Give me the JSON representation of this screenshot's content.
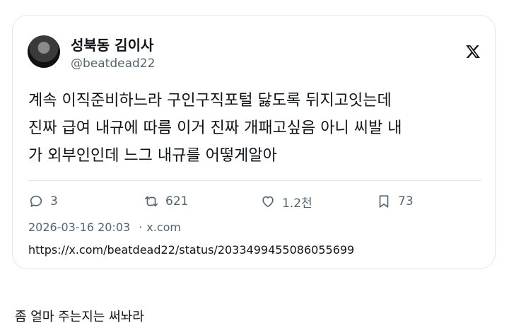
{
  "tweet": {
    "author_name": "성북동 김이사",
    "author_handle": "@beatdead22",
    "text_lines": [
      "계속 이직준비하느라 구인구직포털 닳도록 뒤지고잇는데",
      "진짜 급여 내규에 따름 이거 진짜 개패고싶음 아니 씨발 내",
      "가 외부인인데 느그 내규를 어떻게알아"
    ],
    "actions": {
      "replies": "3",
      "retweets": "621",
      "likes": "1.2천",
      "bookmarks": "73"
    },
    "date": "2026-03-16 20:03",
    "source": "x.com",
    "url": "https://x.com/beatdead22/status/2033499455086055699"
  },
  "post_caption": "좀 얼마 주는지는 써놔라",
  "icons": {
    "logo": "x-logo-icon",
    "reply": "reply-icon",
    "retweet": "retweet-icon",
    "like": "heart-icon",
    "bookmark": "bookmark-icon"
  },
  "colors": {
    "text": "#0f1419",
    "secondary": "#536471",
    "border": "#e3e6ea"
  }
}
